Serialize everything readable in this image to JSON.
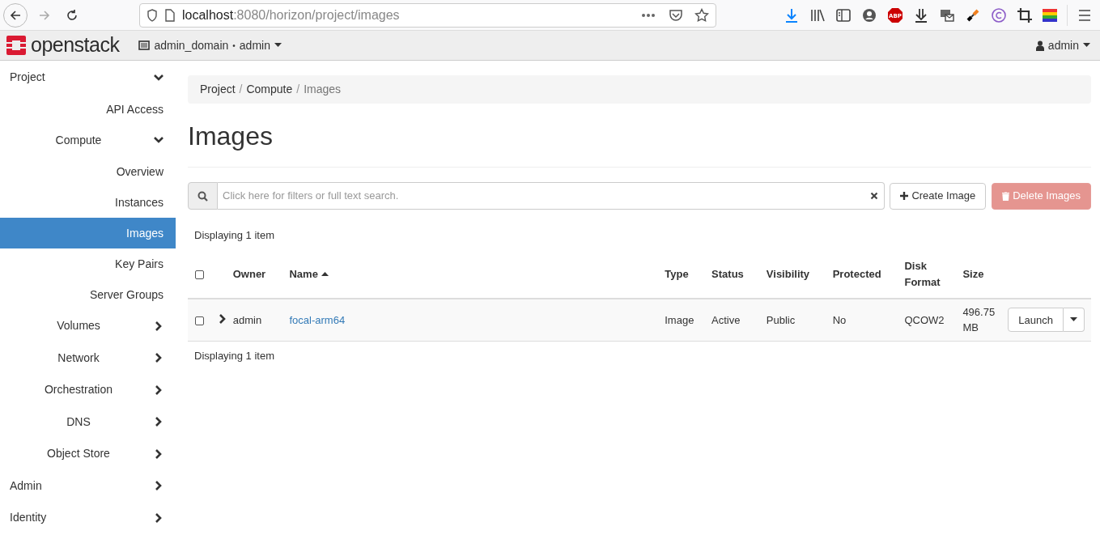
{
  "browser": {
    "url_host": "localhost",
    "url_rest": ":8080/horizon/project/images",
    "adblock_label": "ABP"
  },
  "header": {
    "logo": "openstack",
    "domain": "admin_domain",
    "separator": "•",
    "project": "admin",
    "user": "admin"
  },
  "sidebar": {
    "items": [
      {
        "label": "Project",
        "kind": "group",
        "expanded": true,
        "children": [
          {
            "label": "API Access",
            "kind": "leaf",
            "selected": false
          },
          {
            "label": "Compute",
            "kind": "group",
            "expanded": true,
            "children": [
              {
                "label": "Overview",
                "kind": "leaf",
                "selected": false
              },
              {
                "label": "Instances",
                "kind": "leaf",
                "selected": false
              },
              {
                "label": "Images",
                "kind": "leaf",
                "selected": true
              },
              {
                "label": "Key Pairs",
                "kind": "leaf",
                "selected": false
              },
              {
                "label": "Server Groups",
                "kind": "leaf",
                "selected": false
              }
            ]
          },
          {
            "label": "Volumes",
            "kind": "group",
            "expanded": false
          },
          {
            "label": "Network",
            "kind": "group",
            "expanded": false
          },
          {
            "label": "Orchestration",
            "kind": "group",
            "expanded": false
          },
          {
            "label": "DNS",
            "kind": "group",
            "expanded": false
          },
          {
            "label": "Object Store",
            "kind": "group",
            "expanded": false
          }
        ]
      },
      {
        "label": "Admin",
        "kind": "group",
        "expanded": false
      },
      {
        "label": "Identity",
        "kind": "group",
        "expanded": false
      }
    ]
  },
  "breadcrumb": [
    "Project",
    "Compute",
    "Images"
  ],
  "breadcrumb_separator": "/",
  "title": "Images",
  "search": {
    "placeholder": "Click here for filters or full text search."
  },
  "buttons": [
    {
      "label": "Create Image",
      "kind": "create",
      "disabled": false
    },
    {
      "label": "Delete Images",
      "kind": "delete",
      "disabled": true
    }
  ],
  "table": {
    "summary_top": "Displaying 1 item",
    "summary_bottom": "Displaying 1 item",
    "select_all": {
      "checked": false
    },
    "columns": [
      {
        "label": "Owner",
        "sorted": false
      },
      {
        "label": "Name",
        "sorted": true
      },
      {
        "label": "Type",
        "sorted": false
      },
      {
        "label": "Status",
        "sorted": false
      },
      {
        "label": "Visibility",
        "sorted": false
      },
      {
        "label": "Protected",
        "sorted": false
      },
      {
        "label": "Disk Format",
        "sorted": false
      },
      {
        "label": "Size",
        "sorted": false
      }
    ],
    "rows": [
      {
        "checked": false,
        "expanded": false,
        "owner": "admin",
        "name": "focal-arm64",
        "type": "Image",
        "status": "Active",
        "visibility": "Public",
        "protected": "No",
        "disk_format": "QCOW2",
        "size": "496.75 MB",
        "action": "Launch"
      }
    ]
  }
}
